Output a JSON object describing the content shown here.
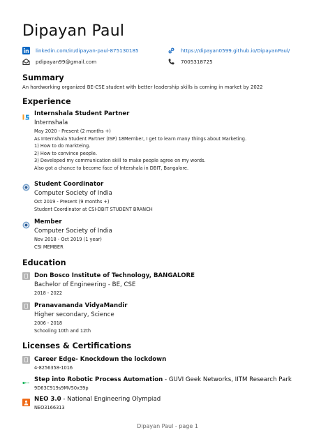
{
  "name": "Dipayan Paul",
  "contacts": {
    "linkedin": "linkedin.com/in/dipayan-paul-875130185",
    "website": "https://dipayan0599.github.io/DipayanPaul/",
    "email": "pdipayan99@gmail.com",
    "phone": "7005318725"
  },
  "sections": {
    "summary": "Summary",
    "experience": "Experience",
    "education": "Education",
    "licenses": "Licenses & Certifications"
  },
  "summary_text": "An hardworking organized BE-CSE student with better leadership skills is coming in market by 2022",
  "experience": [
    {
      "title": "Internshala Student Partner",
      "org": "Internshala",
      "dates": "May 2020 - Present (2 months +)",
      "lines": [
        "As Internshala Student Partner (ISP) 18Member, I get to learn many things about Marketing.",
        "1) How to do markteing.",
        "2) How to convince people.",
        "3) Developed my communication skill to make people agree on my words.",
        "Also got a chance to become face of Intershala in DBIT, Bangalore."
      ]
    },
    {
      "title": "Student Coordinator",
      "org": "Computer Society of India",
      "dates": "Oct 2019 - Present (9 months +)",
      "lines": [
        "Student Coordinator at CSI-DBIT STUDENT BRANCH"
      ]
    },
    {
      "title": "Member",
      "org": "Computer Society of India",
      "dates": "Nov 2018 - Oct 2019 (1 year)",
      "lines": [
        "CSI MEMBER"
      ]
    }
  ],
  "education": [
    {
      "school": "Don Bosco Institute of Technology, BANGALORE",
      "degree": "Bachelor of Engineering - BE, CSE",
      "years": "2018 - 2022"
    },
    {
      "school": "Pranavananda VidyaMandir",
      "degree": "Higher secondary, Science",
      "years": "2006 - 2018",
      "note": "Schooling 10th and 12th"
    }
  ],
  "licenses": [
    {
      "title": "Career Edge- Knockdown the lockdown",
      "issuer": "",
      "id": "4-8256358-1016"
    },
    {
      "title": "Step into Robotic Process Automation",
      "issuer": " - GUVI Geek Networks, IITM Research Park",
      "id": "9D63C919s9MV50x39p"
    },
    {
      "title": "NEO 3.0",
      "issuer": " - National Engineering Olympiad",
      "id": "NEO3166313"
    }
  ],
  "footer": "Dipayan Paul - page 1",
  "colors": {
    "link": "#1f6fc5",
    "linkedin": "#0a66c2",
    "neo": "#ef6c1a"
  }
}
